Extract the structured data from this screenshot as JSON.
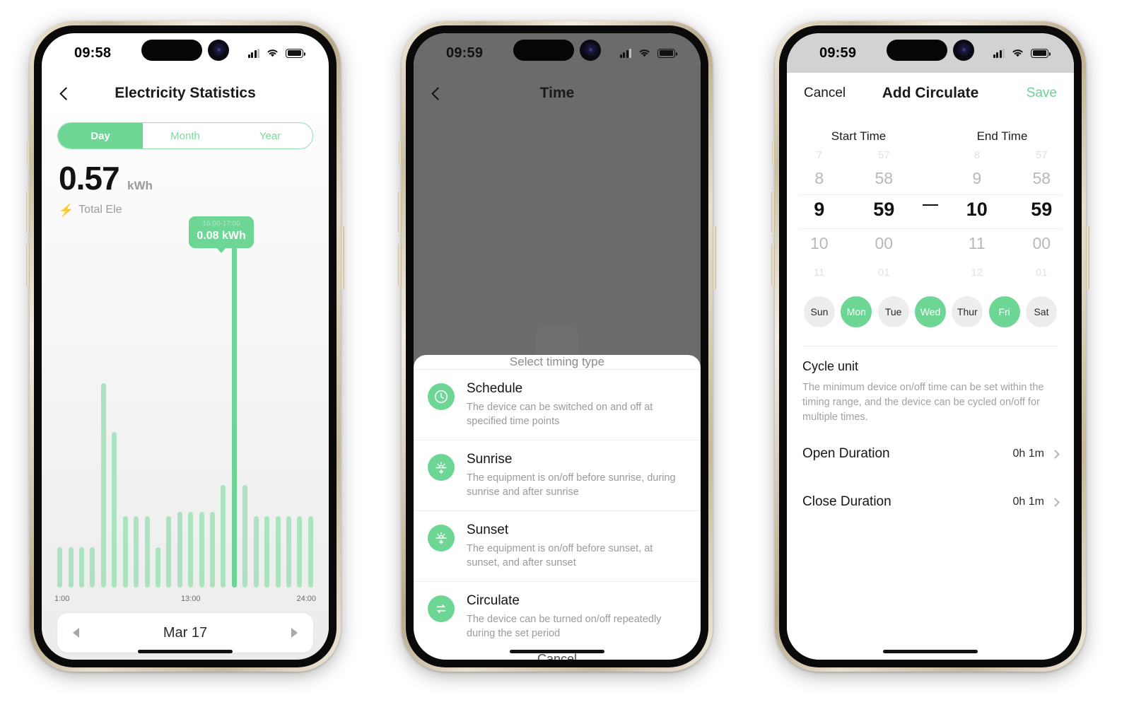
{
  "phone1": {
    "status": {
      "time": "09:58"
    },
    "nav": {
      "title": "Electricity Statistics",
      "back_icon": "chevron-left-icon"
    },
    "segments": [
      {
        "label": "Day",
        "selected": true
      },
      {
        "label": "Month",
        "selected": false
      },
      {
        "label": "Year",
        "selected": false
      }
    ],
    "summary": {
      "value": "0.57",
      "unit": "kWh",
      "icon": "bolt-icon",
      "label": "Total Ele"
    },
    "tooltip": {
      "range": "16:00-17:00",
      "value": "0.08 kWh"
    },
    "date_nav": {
      "prev_icon": "triangle-left-icon",
      "label": "Mar 17",
      "next_icon": "triangle-right-icon"
    },
    "chart_data": {
      "type": "bar",
      "title": "Electricity Statistics",
      "xlabel": "",
      "ylabel": "kWh",
      "ylim": [
        0,
        0.08
      ],
      "grid": false,
      "legend": null,
      "unit": "kWh",
      "highlight_index": 16,
      "annotation": {
        "index": 16,
        "text": "16:00-17:00\n0.08 kWh"
      },
      "tick_labels": [
        "1:00",
        "13:00",
        "24:00"
      ],
      "categories": [
        "1:00",
        "2:00",
        "3:00",
        "4:00",
        "5:00",
        "6:00",
        "7:00",
        "8:00",
        "9:00",
        "10:00",
        "11:00",
        "12:00",
        "13:00",
        "14:00",
        "15:00",
        "16:00",
        "17:00",
        "18:00",
        "19:00",
        "20:00",
        "21:00",
        "22:00",
        "23:00",
        "24:00"
      ],
      "values": [
        0.009,
        0.009,
        0.009,
        0.009,
        0.046,
        0.035,
        0.016,
        0.016,
        0.016,
        0.009,
        0.016,
        0.017,
        0.017,
        0.017,
        0.017,
        0.023,
        0.08,
        0.023,
        0.016,
        0.016,
        0.016,
        0.016,
        0.016,
        0.016
      ]
    }
  },
  "phone2": {
    "status": {
      "time": "09:59"
    },
    "nav": {
      "title": "Time",
      "back_icon": "chevron-left-icon"
    },
    "sheet": {
      "title": "Select timing type",
      "cancel": "Cancel",
      "options": [
        {
          "icon": "clock-icon",
          "title": "Schedule",
          "desc": "The device can be switched on and off at specified time points"
        },
        {
          "icon": "sunrise-icon",
          "title": "Sunrise",
          "desc": "The equipment is on/off before sunrise, during sunrise and after sunrise"
        },
        {
          "icon": "sunset-icon",
          "title": "Sunset",
          "desc": "The equipment is on/off before sunset, at sunset, and after sunset"
        },
        {
          "icon": "cycle-icon",
          "title": "Circulate",
          "desc": "The device can be turned on/off repeatedly during the set period"
        }
      ]
    }
  },
  "phone3": {
    "status": {
      "time": "09:59"
    },
    "nav": {
      "cancel": "Cancel",
      "title": "Add Circulate",
      "save": "Save"
    },
    "picker": {
      "start_label": "Start Time",
      "end_label": "End Time",
      "separator": "—",
      "start_hour": {
        "above2": "7",
        "above1": "8",
        "selected": "9",
        "below1": "10",
        "below2": "11"
      },
      "start_minute": {
        "above2": "57",
        "above1": "58",
        "selected": "59",
        "below1": "00",
        "below2": "01"
      },
      "end_hour": {
        "above2": "8",
        "above1": "9",
        "selected": "10",
        "below1": "11",
        "below2": "12"
      },
      "end_minute": {
        "above2": "57",
        "above1": "58",
        "selected": "59",
        "below1": "00",
        "below2": "01"
      }
    },
    "days": [
      {
        "label": "Sun",
        "selected": false
      },
      {
        "label": "Mon",
        "selected": true
      },
      {
        "label": "Tue",
        "selected": false
      },
      {
        "label": "Wed",
        "selected": true
      },
      {
        "label": "Thur",
        "selected": false
      },
      {
        "label": "Fri",
        "selected": true
      },
      {
        "label": "Sat",
        "selected": false
      }
    ],
    "cycle": {
      "title": "Cycle unit",
      "desc": "The minimum device on/off time can be set within the timing range, and the device can be cycled on/off for multiple times."
    },
    "rows": [
      {
        "label": "Open Duration",
        "value": "0h 1m",
        "chevron": "chevron-right-icon"
      },
      {
        "label": "Close Duration",
        "value": "0h 1m",
        "chevron": "chevron-right-icon"
      }
    ]
  },
  "colors": {
    "accent": "#6ed694",
    "bar": "#abe3c0",
    "chip_off": "#ededed",
    "bolt": "#f4c430"
  }
}
